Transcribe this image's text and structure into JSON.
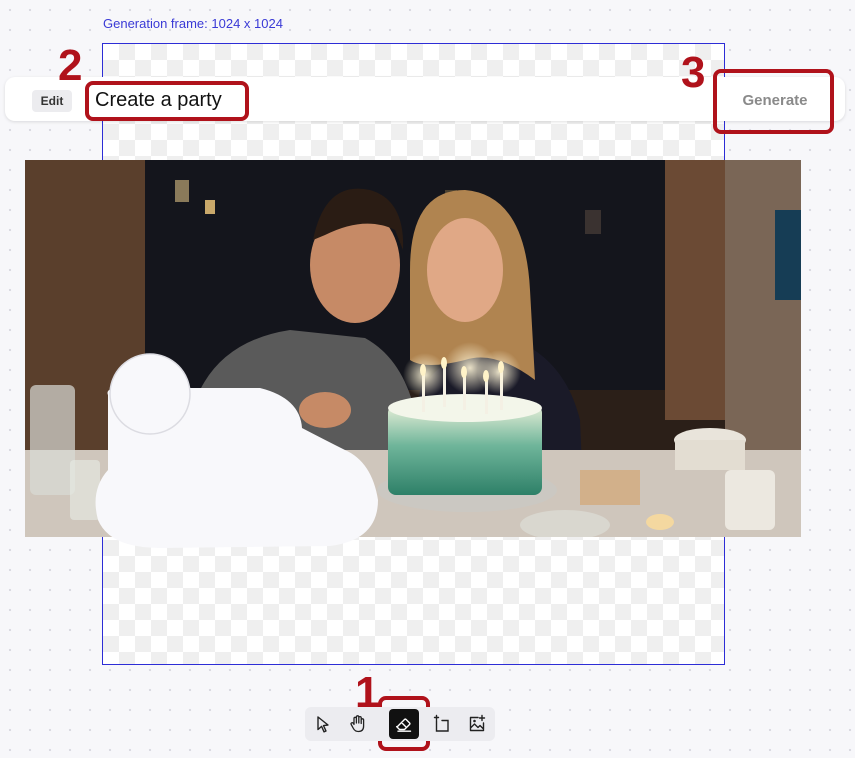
{
  "canvas": {
    "frame_label": "Generation frame: 1024 x 1024"
  },
  "prompt_bar": {
    "edit_label": "Edit",
    "prompt_value": "Create a party",
    "generate_label": "Generate"
  },
  "annotations": {
    "step1": "1",
    "step2": "2",
    "step3": "3"
  },
  "toolbar": {
    "tools": [
      {
        "name": "select",
        "icon": "cursor-arrow-icon",
        "active": false
      },
      {
        "name": "pan",
        "icon": "hand-icon",
        "active": false
      },
      {
        "name": "eraser",
        "icon": "eraser-icon",
        "active": true
      },
      {
        "name": "add-frame",
        "icon": "frame-plus-icon",
        "active": false
      },
      {
        "name": "add-image",
        "icon": "image-plus-icon",
        "active": false
      }
    ]
  },
  "colors": {
    "annotation_red": "#b0121b",
    "frame_blue": "#2d2dd6",
    "active_tool": "#111111"
  }
}
